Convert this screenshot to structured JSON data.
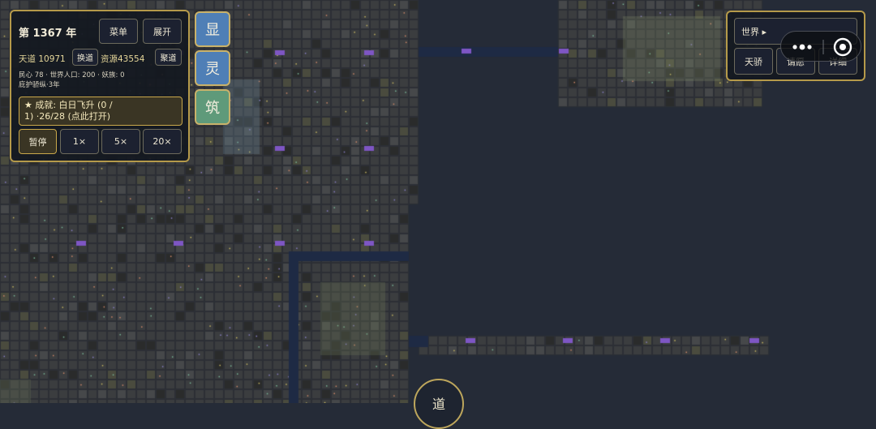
{
  "hud": {
    "year_label": "第 1367 年",
    "menu_label": "菜单",
    "expand_label": "展开",
    "tiandao_text": "天道 10971",
    "swap_label": "换道",
    "resources_text": "资源43554",
    "gather_label": "聚道",
    "stats_line": "民心 78 · 世界人口: 200 · 妖族: 0",
    "protect_line": "庇护骄纵·3年",
    "achievement_line1": "★ 成就: 白日飞升 (0 /",
    "achievement_line2": "1) ·26/28 (点此打开)",
    "speed_buttons": [
      "暂停",
      "1×",
      "5×",
      "20×"
    ]
  },
  "side_buttons": [
    {
      "label": "显",
      "color": "#4f7fb6"
    },
    {
      "label": "灵",
      "color": "#4f7fb6"
    },
    {
      "label": "筑",
      "color": "#5f9a7a"
    }
  ],
  "world_panel": {
    "title": "世界 ▸",
    "buttons": [
      "天骄",
      "请愿",
      "详细"
    ]
  },
  "bottom_button": {
    "label": "道"
  },
  "colors": {
    "accent": "#b59a4a",
    "background": "#252b37",
    "grid": "#3d4148"
  }
}
